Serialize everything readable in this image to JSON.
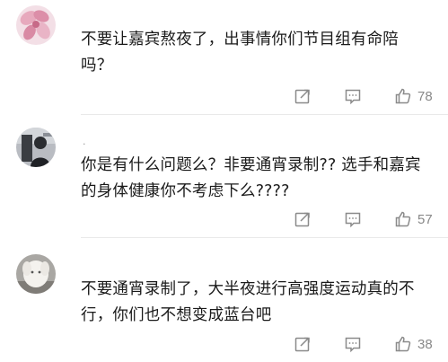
{
  "comments": [
    {
      "avatar": "pink-flower-avatar",
      "lines": [
        "不要让嘉宾熬夜了，出事情你们节目组有命陪",
        "吗？"
      ],
      "likes": "78"
    },
    {
      "avatar": "dark-figure-avatar",
      "username_hint": "·",
      "lines": [
        "你是有什么问题么？非要通宵录制?? 选手和嘉宾",
        "的身体健康你不考虑下么????"
      ],
      "likes": "57"
    },
    {
      "avatar": "white-dog-avatar",
      "lines": [
        "不要通宵录制了，大半夜进行高强度运动真的不",
        "行，你们也不想变成蓝台吧"
      ],
      "likes": "38"
    }
  ],
  "icons": {
    "share": "share-edit-icon",
    "reply": "comment-bubble-icon",
    "like": "thumbs-up-icon"
  },
  "colors": {
    "text": "#1a1a1a",
    "meta": "#888888",
    "icon": "#8a8a8a",
    "divider": "#e9e9e9"
  }
}
